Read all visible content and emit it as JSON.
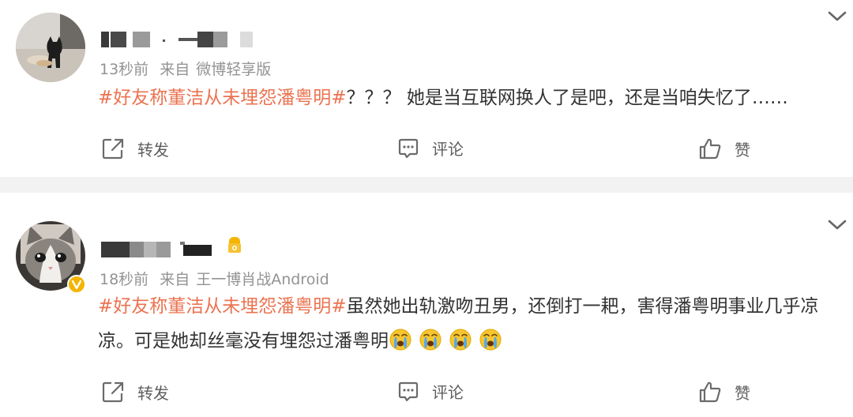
{
  "posts": [
    {
      "time": "13秒前",
      "source_prefix": "来自",
      "source": "微博轻享版",
      "hashtag": "#好友称董洁从未埋怨潘粤明#",
      "text": "？？？ 她是当互联网换人了是吧，还是当咱失忆了……",
      "emoji_count": 0,
      "actions": {
        "repost": "转发",
        "comment": "评论",
        "like": "赞"
      }
    },
    {
      "time": "18秒前",
      "source_prefix": "来自",
      "source": "王一博肖战Android",
      "hashtag": "#好友称董洁从未埋怨潘粤明#",
      "text": "虽然她出轨激吻丑男，还倒打一耙，害得潘粤明事业几乎凉凉。可是她却丝毫没有埋怨过潘粤明",
      "emoji_count": 4,
      "emoji_icon": "crying-face-icon",
      "verified": true,
      "actions": {
        "repost": "转发",
        "comment": "评论",
        "like": "赞"
      }
    }
  ],
  "colors": {
    "hashtag": "#eb7350",
    "meta": "#939393",
    "separator": "#f2f2f2",
    "badge": "#f4b400"
  }
}
